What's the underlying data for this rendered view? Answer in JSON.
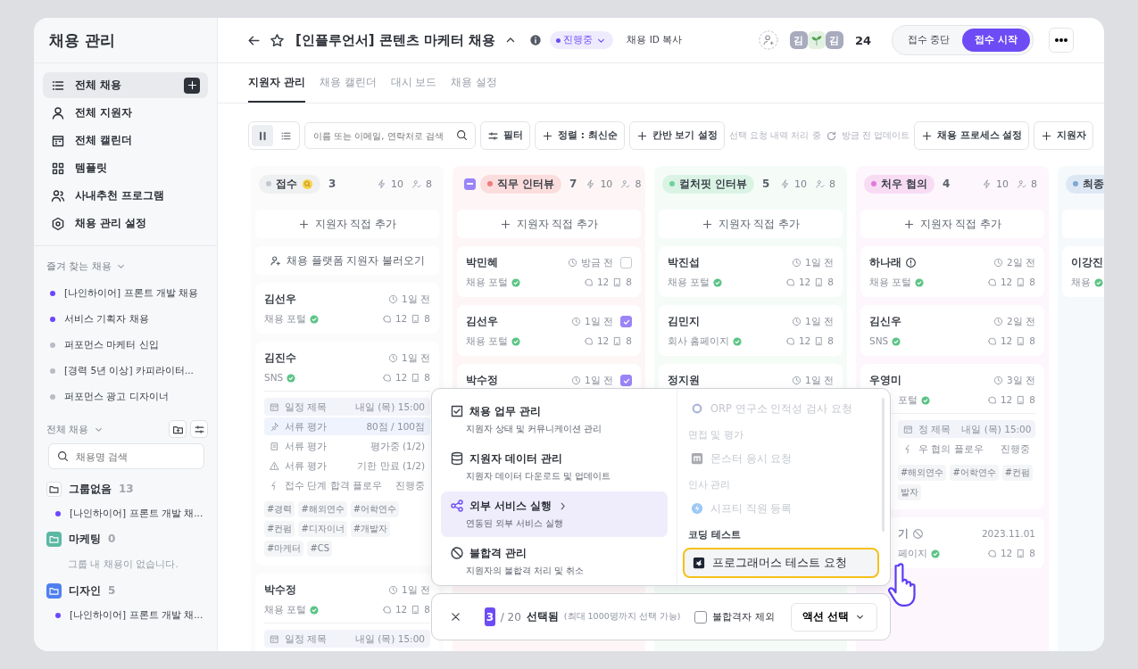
{
  "sidebar": {
    "title": "채용 관리",
    "nav": [
      {
        "label": "전체 채용",
        "selected": true
      },
      {
        "label": "전체 지원자",
        "selected": false
      },
      {
        "label": "전체 캘린더",
        "selected": false
      },
      {
        "label": "템플릿",
        "selected": false
      },
      {
        "label": "사내추천 프로그램",
        "selected": false
      },
      {
        "label": "채용 관리 설정",
        "selected": false
      }
    ],
    "favorites": {
      "title": "즐겨 찾는 채용",
      "items": [
        {
          "label": "[나인하이어] 프론트 개발 채용",
          "color": "#6c47ff"
        },
        {
          "label": "서비스 기획자 채용",
          "color": "#6c47ff"
        },
        {
          "label": "퍼포먼스 마케터 신입",
          "color": "#b8bcc6"
        },
        {
          "label": "[경력 5년 이상] 카피라이터...",
          "color": "#b8bcc6"
        },
        {
          "label": "퍼포먼스 광고 디자이너",
          "color": "#b8bcc6"
        }
      ]
    },
    "all_jobs": {
      "title": "전체 채용",
      "search": {
        "placeholder": "채용명 검색"
      },
      "groups": [
        {
          "name": "그룹없음",
          "count": "13",
          "color": "#ffffff",
          "items": [
            "[나인하이어] 프론트 개발 채..."
          ]
        },
        {
          "name": "마케팅",
          "count": "0",
          "color": "#5db8a3",
          "empty_text": "그룹 내 채용이 없습니다."
        },
        {
          "name": "디자인",
          "count": "5",
          "color": "#4f80f0",
          "items": [
            "[나인하이어] 프론트 개발 채..."
          ]
        }
      ]
    }
  },
  "header": {
    "title": "[인플루언서] 콘텐츠 마케터 채용",
    "status": "진행중",
    "copy_id": "채용 ID 복사",
    "avatars": [
      {
        "kind": "initial",
        "text": "김"
      },
      {
        "kind": "sprout"
      },
      {
        "kind": "initial",
        "text": "김"
      }
    ],
    "member_count": "24",
    "reception": [
      {
        "label": "접수 중단",
        "selected": false
      },
      {
        "label": "접수 시작",
        "selected": true
      }
    ]
  },
  "tabs": [
    {
      "label": "지원자 관리",
      "selected": true
    },
    {
      "label": "채용 캘린더",
      "selected": false
    },
    {
      "label": "대시 보드",
      "selected": false
    },
    {
      "label": "채용 설정",
      "selected": false
    }
  ],
  "toolbar": {
    "view_modes": [
      {
        "selected": true
      },
      {
        "selected": false
      }
    ],
    "search": {
      "placeholder": "이름 또는 이메일, 연락처로 검색"
    },
    "filter": "필터",
    "sort": "정렬 : 최신순",
    "kanban_settings": "칸반 보기 설정",
    "sync_status": "선택 요청 내역 처리 중",
    "updated": "방금 전 업데이트",
    "process_settings": "채용 프로세스 설정",
    "applicants": "지원자"
  },
  "columns": [
    {
      "name": "접수",
      "color": "#c3c7cf",
      "count": "3",
      "bolts": "10",
      "people": "8",
      "add_label": "지원자 직접 추가",
      "import_label": "채용 플랫폼 지원자 불러오기",
      "cards": [
        {
          "name": "김선우",
          "time": "1일 전",
          "source": "채용 포털",
          "comments": "12",
          "files": "8"
        },
        {
          "name": "김진수",
          "time": "1일 전",
          "source": "SNS",
          "comments": "12",
          "files": "8",
          "details": [
            {
              "kind": "schedule",
              "label": "일정 제목",
              "value": "내일 (목) 15:00"
            },
            {
              "kind": "score",
              "label": "서류 평가",
              "value": "80점 / 100점"
            },
            {
              "kind": "progress",
              "label": "서류 평가",
              "value": "평가중 (1/2)"
            },
            {
              "kind": "expired",
              "label": "서류 평가",
              "value": "기한 만료 (1/2)"
            },
            {
              "kind": "flow",
              "label": "접수 단계 합격 플로우",
              "value": "진행중"
            }
          ],
          "tags": [
            "#경력",
            "#해외연수",
            "#어학연수",
            "#컨펌",
            "#디자이너",
            "#개발자",
            "#마케터",
            "#CS"
          ]
        },
        {
          "name": "박수정",
          "time": "1일 전",
          "source": "채용 포털",
          "comments": "12",
          "files": "8",
          "details": [
            {
              "kind": "schedule",
              "label": "일정 제목",
              "value": "내일 (목) 15:00"
            }
          ]
        }
      ]
    },
    {
      "name": "직무 인터뷰",
      "color": "#f27b7b",
      "count": "7",
      "bolts": "10",
      "people": "8",
      "partially_checked": true,
      "add_label": "지원자 직접 추가",
      "cards": [
        {
          "name": "박민혜",
          "time": "방금 전",
          "checked": false,
          "source": "채용 포털",
          "comments": "12",
          "files": "8"
        },
        {
          "name": "김선우",
          "time": "1일 전",
          "checked": true,
          "source": "채용 포털",
          "comments": "12",
          "files": "8"
        },
        {
          "name": "박수정",
          "time": "1일 전",
          "checked": true
        }
      ]
    },
    {
      "name": "컬처핏 인터뷰",
      "color": "#6dd39b",
      "count": "5",
      "bolts": "10",
      "people": "8",
      "add_label": "지원자 직접 추가",
      "cards": [
        {
          "name": "박진섭",
          "time": "1일 전",
          "source": "채용 포털",
          "comments": "12",
          "files": "8"
        },
        {
          "name": "김민지",
          "time": "1일 전",
          "source": "회사 홈페이지",
          "comments": "12",
          "files": "8"
        },
        {
          "name": "정지원",
          "time": "1일 전"
        }
      ]
    },
    {
      "name": "처우 협의",
      "color": "#e07ad8",
      "count": "4",
      "bolts": "10",
      "people": "8",
      "add_label": "지원자 직접 추가",
      "cards": [
        {
          "name": "하나래",
          "alert": true,
          "time": "2일 전",
          "source": "채용 포털",
          "comments": "12",
          "files": "8"
        },
        {
          "name": "김신우",
          "time": "2일 전",
          "source": "SNS",
          "comments": "12",
          "files": "8"
        },
        {
          "name": "우영미",
          "time": "3일 전",
          "body_covered": true,
          "source": "포털",
          "comments": "12",
          "files": "8",
          "details": [
            {
              "kind": "schedule",
              "label": "정 제목",
              "value": "내일 (목) 15:00"
            },
            {
              "kind": "flow",
              "label": "우 협의 플로우",
              "value": "진행중"
            }
          ],
          "tags": [
            "#해외연수",
            "#어학연수",
            "#컨펌",
            "발자"
          ]
        },
        {
          "name": "기",
          "rejected": true,
          "header_covered": true,
          "body_covered": true,
          "time": "2023.11.01",
          "source": "페이지",
          "comments": "12",
          "files": "8"
        }
      ]
    },
    {
      "name": "최종",
      "color": "#7fa7d8",
      "cards": [
        {
          "name": "이강진",
          "source": "채용"
        }
      ]
    }
  ],
  "action_menu": {
    "menu": [
      {
        "title": "채용 업무 관리",
        "description": "지원자 상태 및 커뮤니케이션 관리",
        "selected": false
      },
      {
        "title": "지원자 데이터 관리",
        "description": "지원자 데이터 다운로드 및 업데이트",
        "selected": false
      },
      {
        "title": "외부 서비스 실행",
        "description": "연동된 외부 서비스 실행",
        "selected": true
      },
      {
        "title": "불합격 관리",
        "description": "지원자의 불합격 처리 및 취소",
        "selected": false
      }
    ],
    "services": [
      {
        "kind": "service",
        "label": "ORP 연구소 인적성 검사 요청",
        "disabled": true,
        "selected": false
      },
      {
        "kind": "group",
        "label": "면접 및 평가",
        "disabled": true
      },
      {
        "kind": "service",
        "label": "몬스터 응시 요청",
        "disabled": true,
        "selected": false
      },
      {
        "kind": "group",
        "label": "인사 관리",
        "disabled": true
      },
      {
        "kind": "service",
        "label": "시프티 직원 등록",
        "disabled": true,
        "selected": false
      },
      {
        "kind": "group",
        "label": "코딩 테스트",
        "disabled": false
      },
      {
        "kind": "service",
        "label": "프로그래머스 테스트 요청",
        "disabled": false,
        "selected": true
      }
    ]
  },
  "selection_bar": {
    "count": "3",
    "total": "/ 20",
    "selected_label": "선택됨",
    "limit_note": "(최대 1000명까지 선택 가능)",
    "exclude_rejected": {
      "label": "불합격자 제외",
      "checked": false
    },
    "action": "액션 선택"
  }
}
